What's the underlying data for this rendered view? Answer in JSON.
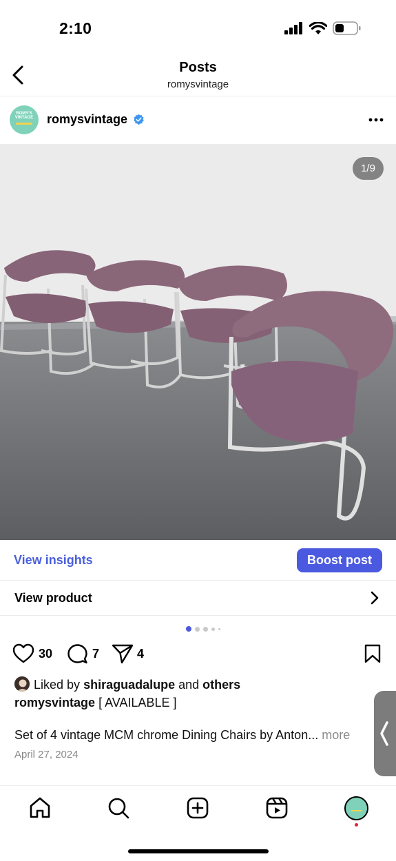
{
  "status_bar": {
    "time": "2:10"
  },
  "header": {
    "title": "Posts",
    "subtitle": "romysvintage"
  },
  "post": {
    "username": "romysvintage",
    "avatar_text": "ROMY'S VINTAGE",
    "image_counter": "1/9",
    "carousel": {
      "total_pages": 9,
      "current_page": 1,
      "visible_dots": 5
    }
  },
  "actions": {
    "view_insights": "View insights",
    "boost_post": "Boost post",
    "view_product": "View product"
  },
  "engagement": {
    "likes": "30",
    "comments": "7",
    "shares": "4"
  },
  "caption": {
    "liked_prefix": "Liked by",
    "liked_user": "shiraguadalupe",
    "liked_and": "and",
    "liked_others": "others",
    "author": "romysvintage",
    "text": "[ AVAILABLE ]",
    "description": "Set of 4 vintage MCM chrome Dining Chairs by Anton...",
    "more": "more",
    "date": "April 27, 2024"
  },
  "icons": {
    "back": "chevron-left-icon",
    "verified": "verified-badge-icon",
    "more": "ellipsis-icon",
    "like": "heart-icon",
    "comment": "comment-icon",
    "share": "send-icon",
    "save": "bookmark-icon",
    "home": "home-icon",
    "search": "search-icon",
    "create": "plus-square-icon",
    "reels": "reels-icon"
  },
  "colors": {
    "accent": "#4b59e0",
    "link": "#4a5fdc",
    "chair_upholstery": "#8a6377",
    "notification": "#e0243b"
  }
}
